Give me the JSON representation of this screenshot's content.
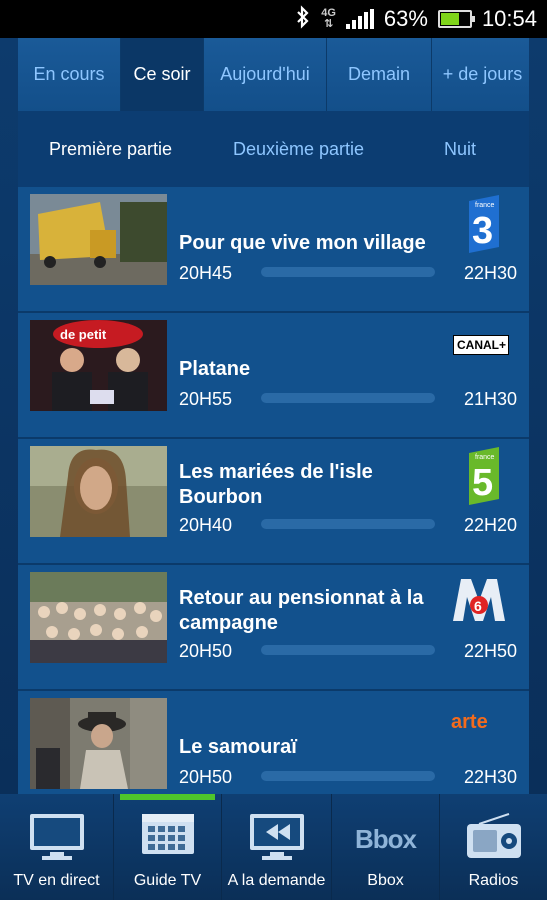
{
  "status_bar": {
    "network": "4G",
    "battery_percent": "63%",
    "battery_level": 0.63,
    "time": "10:54"
  },
  "tabs": [
    {
      "label": "En cours",
      "active": false
    },
    {
      "label": "Ce soir",
      "active": true
    },
    {
      "label": "Aujourd'hui",
      "active": false
    },
    {
      "label": "Demain",
      "active": false
    },
    {
      "label": "+ de jours",
      "active": false
    }
  ],
  "subtabs": [
    {
      "label": "Première partie",
      "active": true
    },
    {
      "label": "Deuxième partie",
      "active": false
    },
    {
      "label": "Nuit",
      "active": false
    }
  ],
  "programs": [
    {
      "title": "Pour que vive mon village",
      "start": "20H45",
      "end": "22H30",
      "channel_icon": "france-3-logo"
    },
    {
      "title": "Platane",
      "start": "20H55",
      "end": "21H30",
      "channel_icon": "canal-plus-logo",
      "channel_text": "CANAL+"
    },
    {
      "title": "Les mariées de l'isle Bourbon",
      "start": "20H40",
      "end": "22H20",
      "channel_icon": "france-5-logo"
    },
    {
      "title": "Retour au pensionnat à la campagne",
      "start": "20H50",
      "end": "22H50",
      "channel_icon": "m6-logo"
    },
    {
      "title": "Le samouraï",
      "start": "20H50",
      "end": "22H30",
      "channel_icon": "arte-logo",
      "channel_text": "arte"
    }
  ],
  "bottom_nav": [
    {
      "label": "TV en direct",
      "icon": "tv-icon",
      "active": false
    },
    {
      "label": "Guide TV",
      "icon": "calendar-grid-icon",
      "active": true
    },
    {
      "label": "A la demande",
      "icon": "rewind-screen-icon",
      "active": false
    },
    {
      "label": "Bbox",
      "icon": "bbox-logo",
      "logo_text": "Bbox",
      "active": false
    },
    {
      "label": "Radios",
      "icon": "radio-icon",
      "active": false
    }
  ],
  "colors": {
    "accent_green": "#4ec62c",
    "tab_text": "#8ec6ff",
    "panel_bg": "#12518d",
    "france3_blue": "#1f6fd1",
    "france5_green": "#69b92a",
    "arte_orange": "#f26b1d"
  }
}
